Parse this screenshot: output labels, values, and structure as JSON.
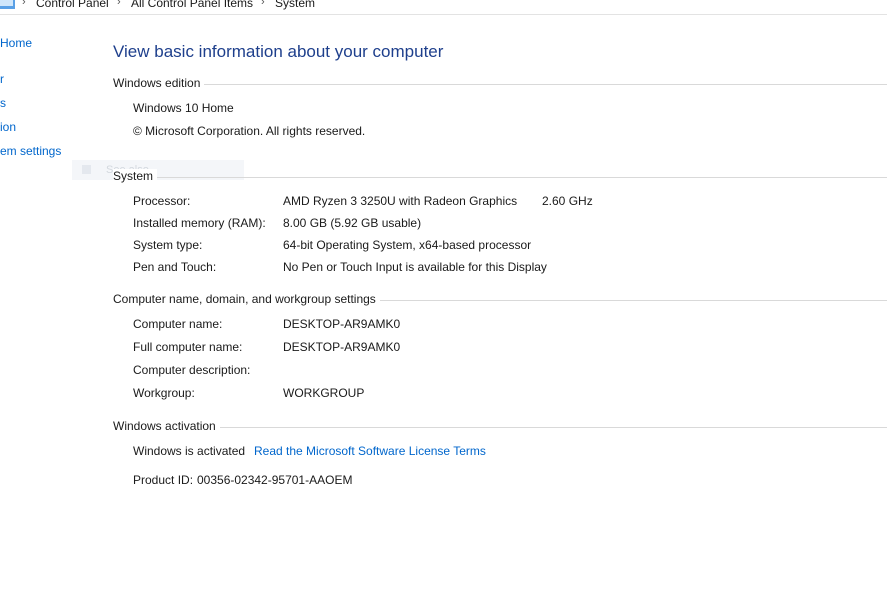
{
  "breadcrumb": {
    "items": [
      "Control Panel",
      "All Control Panel Items",
      "System"
    ],
    "separator": "›"
  },
  "left_nav": {
    "items": [
      "Home",
      "r",
      "s",
      "ion",
      "em settings"
    ],
    "ghost_label": "See also"
  },
  "main": {
    "title": "View basic information about your computer",
    "windows_edition": {
      "heading": "Windows edition",
      "edition": "Windows 10 Home",
      "copyright": "© Microsoft Corporation. All rights reserved."
    },
    "system": {
      "heading": "System",
      "rows": [
        {
          "label": "Processor:",
          "value": "AMD Ryzen 3 3250U with Radeon Graphics",
          "extra": "2.60 GHz"
        },
        {
          "label": "Installed memory (RAM):",
          "value": "8.00 GB (5.92 GB usable)"
        },
        {
          "label": "System type:",
          "value": "64-bit Operating System, x64-based processor"
        },
        {
          "label": "Pen and Touch:",
          "value": "No Pen or Touch Input is available for this Display"
        }
      ]
    },
    "computer_name": {
      "heading": "Computer name, domain, and workgroup settings",
      "rows": [
        {
          "label": "Computer name:",
          "value": "DESKTOP-AR9AMK0"
        },
        {
          "label": "Full computer name:",
          "value": "DESKTOP-AR9AMK0"
        },
        {
          "label": "Computer description:",
          "value": ""
        },
        {
          "label": "Workgroup:",
          "value": "WORKGROUP"
        }
      ]
    },
    "activation": {
      "heading": "Windows activation",
      "status": "Windows is activated",
      "license_link": "Read the Microsoft Software License Terms",
      "product_id_label": "Product ID:",
      "product_id": "00356-02342-95701-AAOEM"
    }
  },
  "colors": {
    "title": "#1e3f8c",
    "link": "#0066cc",
    "rule": "#d9d9d9"
  }
}
